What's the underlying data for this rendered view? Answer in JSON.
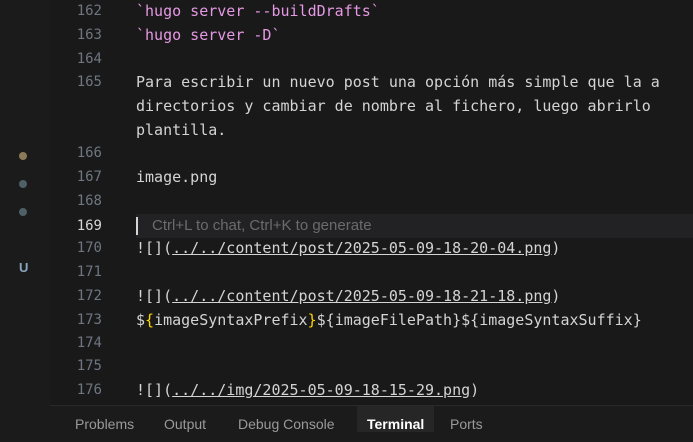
{
  "gutter": {
    "dot_colors": [
      "#8a7a58",
      "#4f6068",
      "#4f6068"
    ],
    "scm_badge": "U"
  },
  "editor": {
    "lines": {
      "l162": {
        "num": "162",
        "text": "`hugo server --buildDrafts`"
      },
      "l163": {
        "num": "163",
        "text": "`hugo server -D`"
      },
      "l164": {
        "num": "164",
        "text": ""
      },
      "l165": {
        "num": "165",
        "wrap1": "Para escribir un nuevo post una opción más simple que la a",
        "wrap2": "directorios y cambiar de nombre al fichero, luego abrirlo",
        "wrap3": "plantilla."
      },
      "l166": {
        "num": "166",
        "text": ""
      },
      "l167": {
        "num": "167",
        "text": "image.png"
      },
      "l168": {
        "num": "168",
        "text": ""
      },
      "l169": {
        "num": "169",
        "hint": "Ctrl+L to chat, Ctrl+K to generate"
      },
      "l170": {
        "num": "170",
        "prefix": "![](",
        "link": "../../content/post/2025-05-09-18-20-04.png",
        "suffix": ")"
      },
      "l171": {
        "num": "171",
        "text": ""
      },
      "l172": {
        "num": "172",
        "prefix": "![](",
        "link": "../../content/post/2025-05-09-18-21-18.png",
        "suffix": ")"
      },
      "l173": {
        "num": "173",
        "d1": "$",
        "b1o": "{",
        "v1": "imageSyntaxPrefix",
        "b1c": "}",
        "d2": "$",
        "b2o": "{",
        "v2": "imageFilePath",
        "b2c": "}",
        "d3": "$",
        "b3o": "{",
        "v3": "imageSyntaxSuffix",
        "b3c": "}"
      },
      "l174": {
        "num": "174",
        "text": ""
      },
      "l175": {
        "num": "175",
        "text": ""
      },
      "l176": {
        "num": "176",
        "prefix": "![](",
        "link": "../../img/2025-05-09-18-15-29.png",
        "suffix": ")"
      }
    }
  },
  "panel": {
    "tabs": {
      "problems": "Problems",
      "output": "Output",
      "debug_console": "Debug Console",
      "terminal": "Terminal",
      "ports": "Ports"
    },
    "active_tab": "Terminal"
  }
}
